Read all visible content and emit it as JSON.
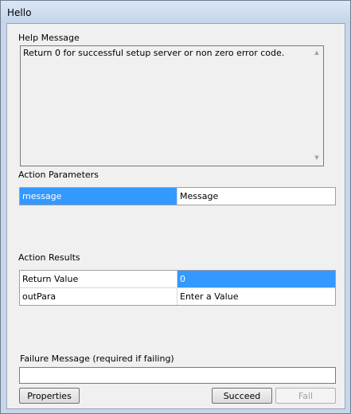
{
  "window": {
    "title": "Hello"
  },
  "help": {
    "label": "Help Message",
    "text": "Return 0 for successful setup server or non zero error code."
  },
  "action_parameters": {
    "label": "Action Parameters",
    "rows": [
      {
        "name": "message",
        "value": "Message"
      }
    ]
  },
  "action_results": {
    "label": "Action Results",
    "rows": [
      {
        "name": "Return Value",
        "value": "0"
      },
      {
        "name": "outPara",
        "value": "Enter a Value"
      }
    ]
  },
  "failure": {
    "label": "Failure Message (required if failing)",
    "value": ""
  },
  "buttons": {
    "properties": "Properties",
    "succeed": "Succeed",
    "fail": "Fail"
  }
}
